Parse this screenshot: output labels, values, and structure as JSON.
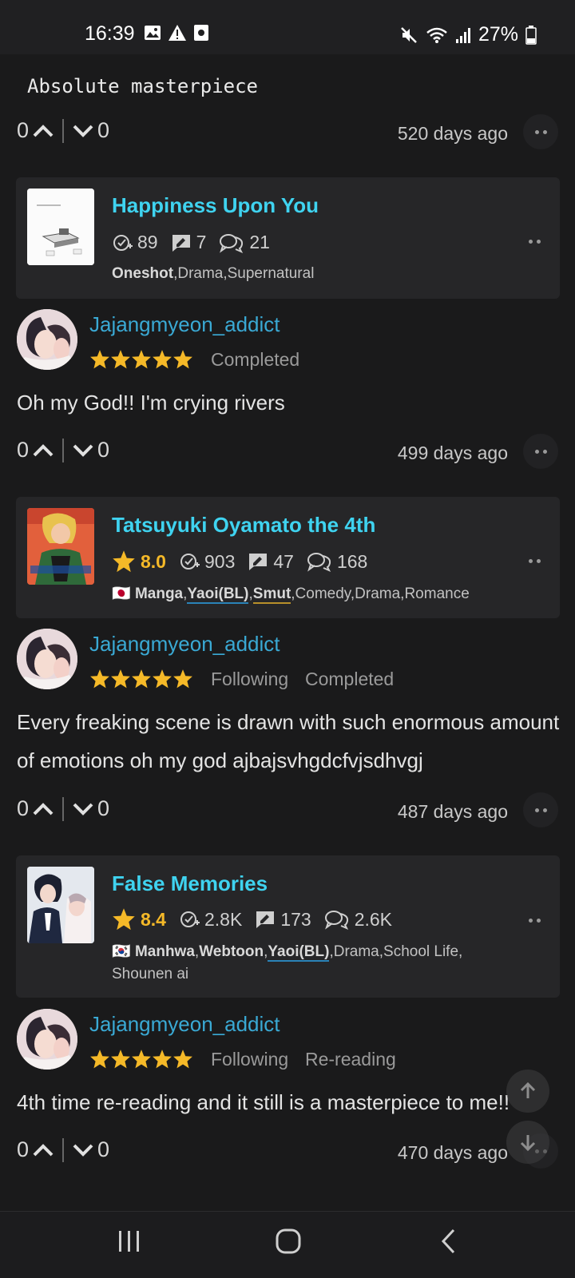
{
  "status_bar": {
    "time": "16:39",
    "battery": "27%"
  },
  "top_comment": {
    "text": "Absolute masterpiece",
    "upvotes": "0",
    "downvotes": "0",
    "ago": "520 days ago"
  },
  "entries": [
    {
      "manga": {
        "title": "Happiness Upon You",
        "follows": "89",
        "reviews": "7",
        "comments": "21",
        "tags_bold": [
          "Oneshot"
        ],
        "tags_plain": ",Drama,Supernatural"
      },
      "review": {
        "user": "Jajangmyeon_addict",
        "stars": 5,
        "status1": "Completed",
        "status2": "",
        "text": "Oh my God!! I'm crying rivers",
        "upvotes": "0",
        "downvotes": "0",
        "ago": "499 days ago"
      }
    },
    {
      "manga": {
        "title": "Tatsuyuki Oyamato the 4th",
        "rating": "8.0",
        "follows": "903",
        "reviews": "47",
        "comments": "168",
        "flag": "🇯🇵",
        "tag1": "Manga",
        "tag2": "Yaoi(BL)",
        "tag3": "Smut",
        "tags_plain": ",Comedy,Drama,Romance"
      },
      "review": {
        "user": "Jajangmyeon_addict",
        "stars": 5,
        "status1": "Following",
        "status2": "Completed",
        "text": "Every freaking scene is drawn with such enormous amount of emotions oh my god ajbajsvhgdcfvjsdhvgj",
        "upvotes": "0",
        "downvotes": "0",
        "ago": "487 days ago"
      }
    },
    {
      "manga": {
        "title": "False Memories",
        "rating": "8.4",
        "follows": "2.8K",
        "reviews": "173",
        "comments": "2.6K",
        "flag": "🇰🇷",
        "tag1": "Manhwa",
        "tag2": "Webtoon",
        "tag3": "Yaoi(BL)",
        "tags_plain": ",Drama,School Life,",
        "tags_line2": "Shounen ai"
      },
      "review": {
        "user": "Jajangmyeon_addict",
        "stars": 5,
        "status1": "Following",
        "status2": "Re-reading",
        "text": "4th time re-reading and it still is a masterpiece to me!!",
        "upvotes": "0",
        "downvotes": "0",
        "ago": "470 days ago"
      }
    }
  ],
  "colors": {
    "accent_title": "#3fd3f0",
    "username": "#3aa9d4",
    "star": "#f5b928",
    "background": "#1a1a1b",
    "card": "#262628"
  }
}
